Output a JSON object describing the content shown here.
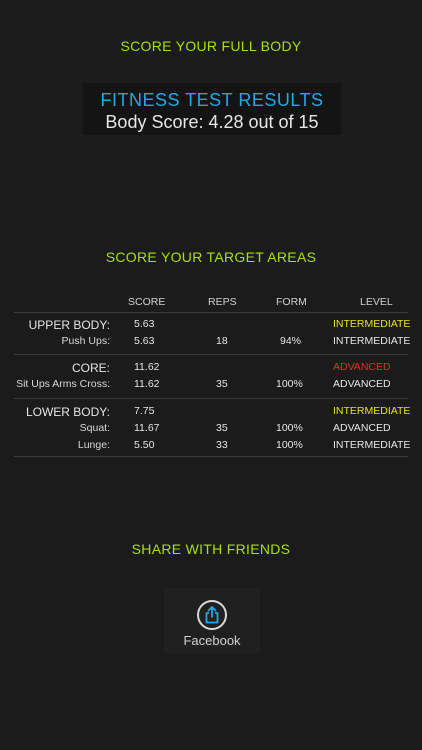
{
  "sections": {
    "full_body": "SCORE YOUR FULL BODY",
    "target_areas": "SCORE YOUR TARGET AREAS",
    "share": "SHARE WITH FRIENDS"
  },
  "results": {
    "title": "FITNESS TEST RESULTS",
    "score_text": "Body Score: 4.28 out of 15"
  },
  "table": {
    "headers": {
      "score": "SCORE",
      "reps": "REPS",
      "form": "FORM",
      "level": "LEVEL"
    },
    "groups": [
      {
        "name": "UPPER BODY:",
        "score": "5.63",
        "level": "INTERMEDIATE",
        "level_color": "#e8e020",
        "rows": [
          {
            "name": "Push Ups:",
            "score": "5.63",
            "reps": "18",
            "form": "94%",
            "level": "INTERMEDIATE"
          }
        ]
      },
      {
        "name": "CORE:",
        "score": "11.62",
        "level": "ADVANCED",
        "level_color": "#e03020",
        "rows": [
          {
            "name": "Sit Ups Arms Cross:",
            "score": "11.62",
            "reps": "35",
            "form": "100%",
            "level": "ADVANCED"
          }
        ]
      },
      {
        "name": "LOWER BODY:",
        "score": "7.75",
        "level": "INTERMEDIATE",
        "level_color": "#e8e020",
        "rows": [
          {
            "name": "Squat:",
            "score": "11.67",
            "reps": "35",
            "form": "100%",
            "level": "ADVANCED"
          },
          {
            "name": "Lunge:",
            "score": "5.50",
            "reps": "33",
            "form": "100%",
            "level": "INTERMEDIATE"
          }
        ]
      }
    ]
  },
  "share": {
    "label": "Facebook",
    "icon": "share-icon",
    "icon_color": "#21a8e8"
  }
}
